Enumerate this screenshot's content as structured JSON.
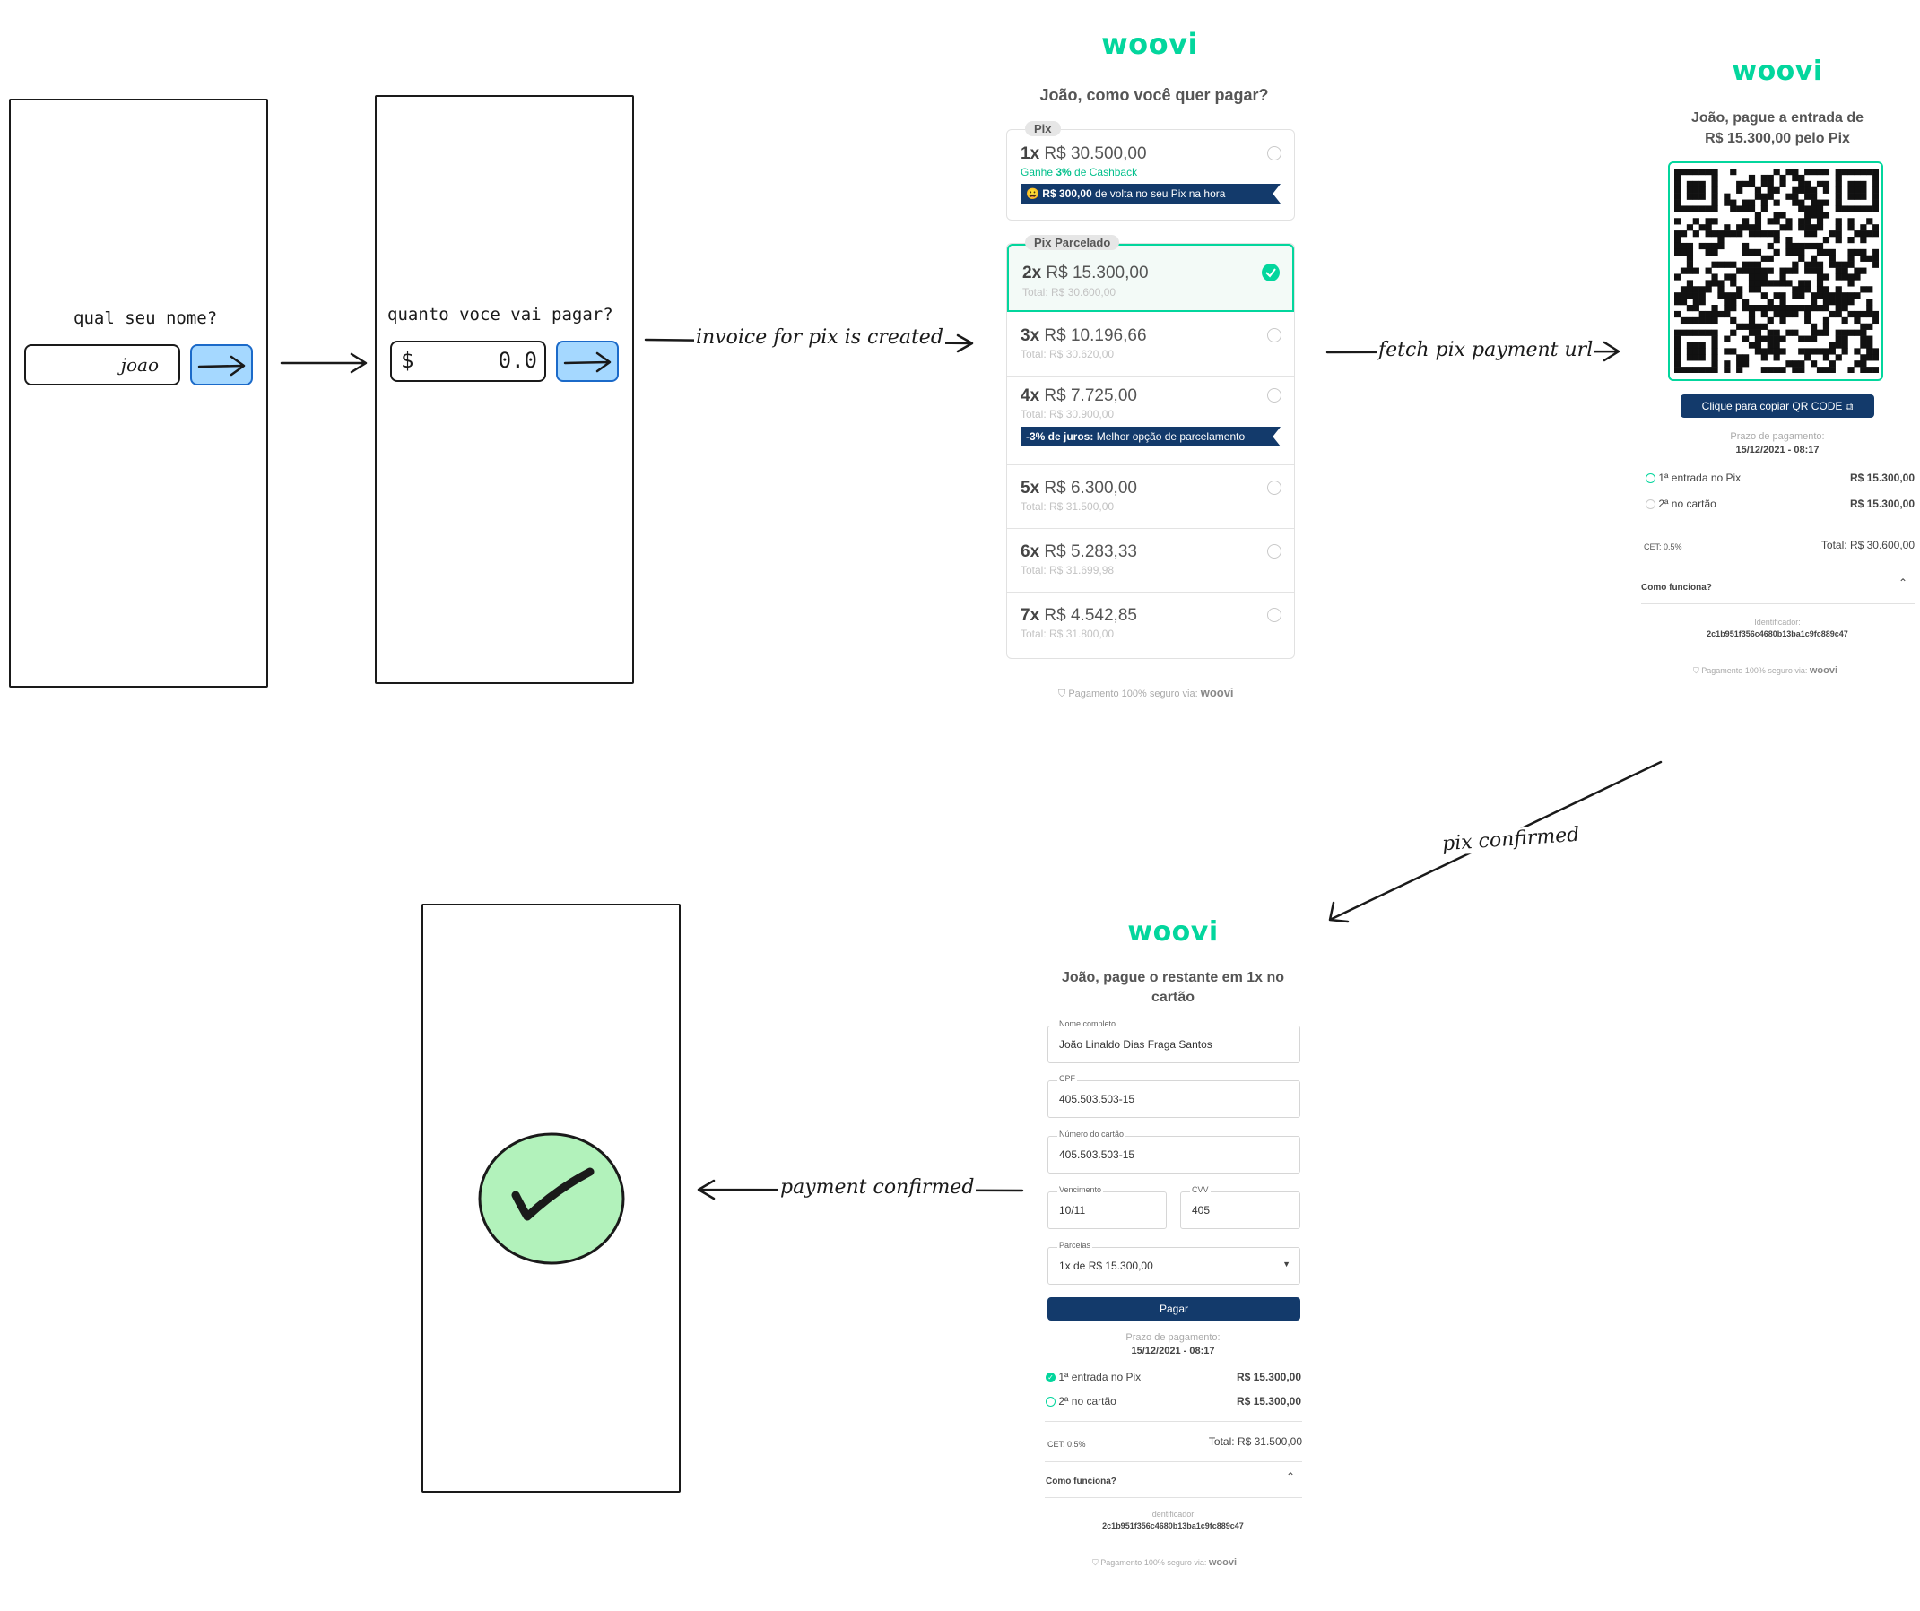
{
  "sketch": {
    "name_question": "qual seu nome?",
    "name_value": "joao",
    "amount_question": "quanto voce vai pagar?",
    "currency_symbol": "$",
    "amount_value": "0.0"
  },
  "arrows": {
    "invoice": "invoice for pix is created",
    "fetch": "fetch pix payment url",
    "pix_confirmed": "pix confirmed",
    "payment_confirmed": "payment confirmed"
  },
  "brand": "woovi",
  "screen_options": {
    "title": "João, como você quer pagar?",
    "pix_chip": "Pix",
    "pix_option": {
      "count": "1x",
      "amount": "R$ 30.500,00"
    },
    "cashback_pre": "Ganhe ",
    "cashback_bold": "3%",
    "cashback_post": " de Cashback",
    "cashback_banner_bold": "R$ 300,00",
    "cashback_banner_text": " de volta no seu Pix na hora",
    "parcelado_chip": "Pix Parcelado",
    "installments": [
      {
        "count": "2x",
        "amount": "R$ 15.300,00",
        "total": "Total: R$ 30.600,00"
      },
      {
        "count": "3x",
        "amount": "R$ 10.196,66",
        "total": "Total: R$ 30.620,00"
      },
      {
        "count": "4x",
        "amount": "R$ 7.725,00",
        "total": "Total: R$ 30.900,00"
      },
      {
        "count": "5x",
        "amount": "R$ 6.300,00",
        "total": "Total: R$ 31.500,00"
      },
      {
        "count": "6x",
        "amount": "R$ 5.283,33",
        "total": "Total: R$ 31.699,98"
      },
      {
        "count": "7x",
        "amount": "R$ 4.542,85",
        "total": "Total: R$ 31.800,00"
      }
    ],
    "best_banner_bold": "-3% de juros:",
    "best_banner_text": " Melhor opção de parcelamento",
    "footer": "Pagamento 100% seguro via:"
  },
  "screen_qr": {
    "title_line1": "João, pague a entrada de",
    "title_line2": "R$ 15.300,00 pelo Pix",
    "copy_button": "Clique para copiar QR CODE",
    "deadline_label": "Prazo de pagamento:",
    "deadline_value": "15/12/2021 - 08:17",
    "step1_label": "1ª entrada no Pix",
    "step1_amount": "R$ 15.300,00",
    "step2_label": "2ª no cartão",
    "step2_amount": "R$ 15.300,00",
    "cet": "CET: 0.5%",
    "total": "Total: R$ 30.600,00",
    "how_it_works": "Como funciona?",
    "identifier_label": "Identificador:",
    "identifier_value": "2c1b951f356c4680b13ba1c9fc889c47",
    "footer": "Pagamento 100% seguro via:"
  },
  "screen_card": {
    "title_line1": "João, pague o restante em 1x no",
    "title_line2": "cartão",
    "name_label": "Nome completo",
    "name_value": "João Linaldo Dias Fraga Santos",
    "cpf_label": "CPF",
    "cpf_value": "405.503.503-15",
    "card_label": "Número do cartão",
    "card_value": "405.503.503-15",
    "exp_label": "Vencimento",
    "exp_value": "10/11",
    "cvv_label": "CVV",
    "cvv_value": "405",
    "parcelas_label": "Parcelas",
    "parcelas_value": "1x de R$ 15.300,00",
    "pay_button": "Pagar",
    "deadline_label": "Prazo de pagamento:",
    "deadline_value": "15/12/2021 - 08:17",
    "step1_label": "1ª entrada no Pix",
    "step1_amount": "R$ 15.300,00",
    "step2_label": "2ª no cartão",
    "step2_amount": "R$ 15.300,00",
    "cet": "CET: 0.5%",
    "total": "Total: R$ 31.500,00",
    "how_it_works": "Como funciona?",
    "identifier_label": "Identificador:",
    "identifier_value": "2c1b951f356c4680b13ba1c9fc889c47",
    "footer": "Pagamento 100% seguro via:"
  },
  "colors": {
    "brand": "#03d69d",
    "navy": "#133a6b",
    "sketch_blue": "#a5d8ff",
    "check_green": "#b2f2bb"
  }
}
